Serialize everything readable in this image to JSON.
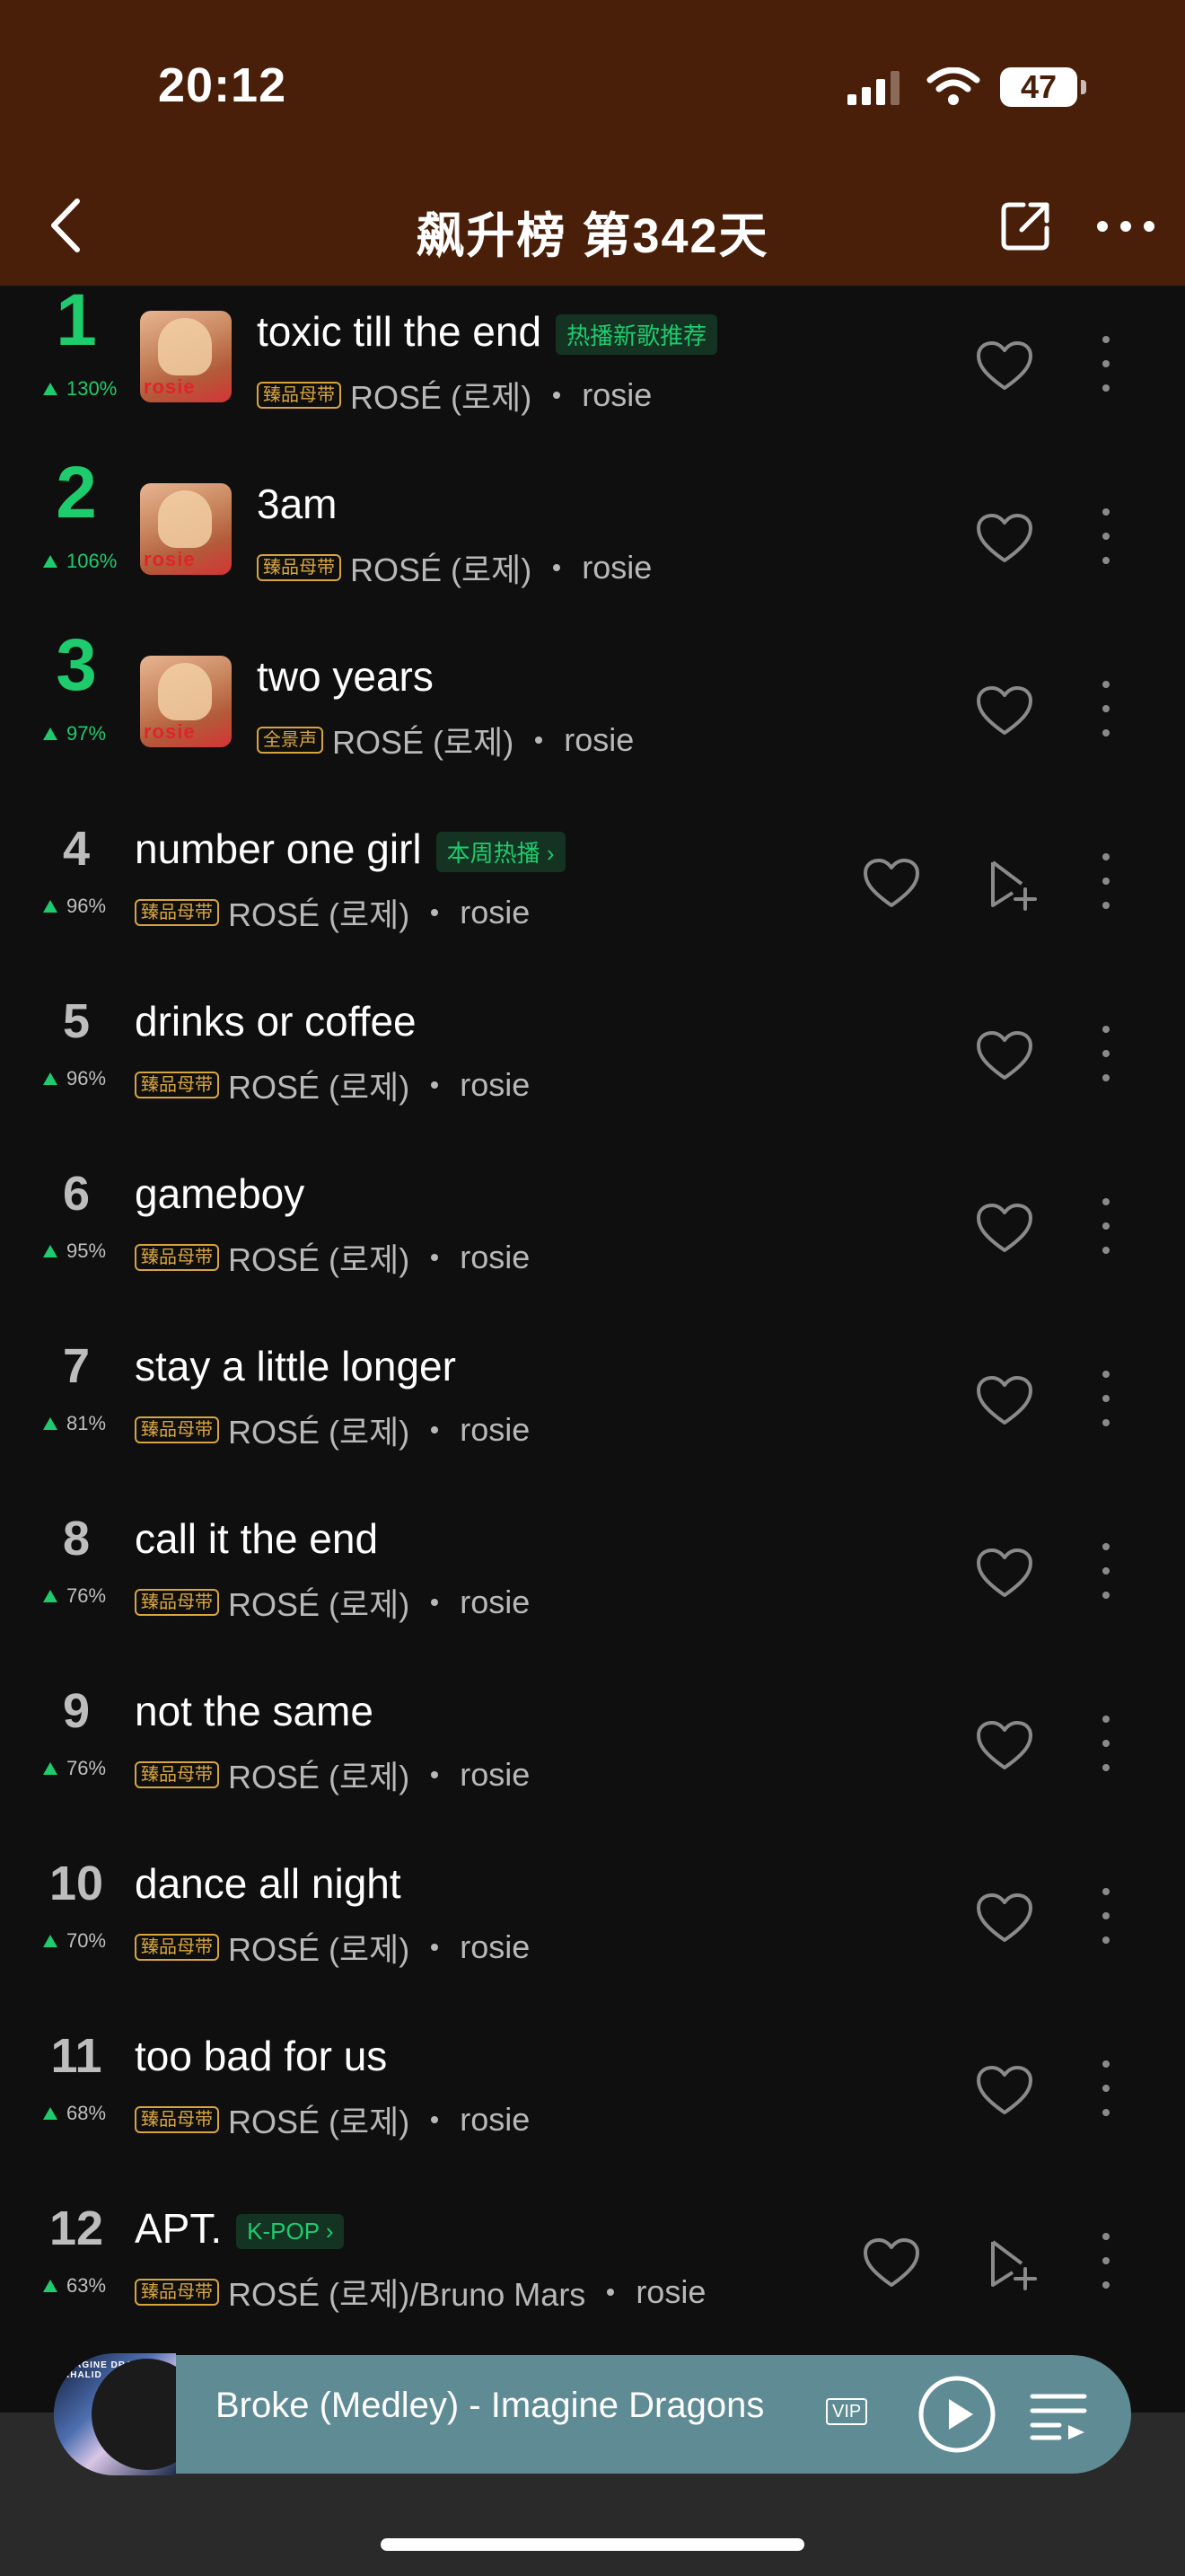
{
  "status_bar": {
    "time": "20:12",
    "battery": "47"
  },
  "header": {
    "title": "飙升榜 第342天"
  },
  "songs": [
    {
      "rank": "1",
      "trend": "130%",
      "title": "toxic till the end",
      "tag": "热播新歌推荐",
      "quality": "臻品母带",
      "artist": "ROSÉ (로제)",
      "album": "rosie",
      "cover_text": "rosie"
    },
    {
      "rank": "2",
      "trend": "106%",
      "title": "3am",
      "quality": "臻品母带",
      "artist": "ROSÉ (로제)",
      "album": "rosie",
      "cover_text": "rosie"
    },
    {
      "rank": "3",
      "trend": "97%",
      "title": "two years",
      "quality": "全景声",
      "artist": "ROSÉ (로제)",
      "album": "rosie",
      "cover_text": "rosie"
    },
    {
      "rank": "4",
      "trend": "96%",
      "title": "number one girl",
      "tag": "本周热播 ›",
      "quality": "臻品母带",
      "artist": "ROSÉ (로제)",
      "album": "rosie"
    },
    {
      "rank": "5",
      "trend": "96%",
      "title": "drinks or coffee",
      "quality": "臻品母带",
      "artist": "ROSÉ (로제)",
      "album": "rosie"
    },
    {
      "rank": "6",
      "trend": "95%",
      "title": "gameboy",
      "quality": "臻品母带",
      "artist": "ROSÉ (로제)",
      "album": "rosie"
    },
    {
      "rank": "7",
      "trend": "81%",
      "title": "stay a little longer",
      "quality": "臻品母带",
      "artist": "ROSÉ (로제)",
      "album": "rosie"
    },
    {
      "rank": "8",
      "trend": "76%",
      "title": "call it the end",
      "quality": "臻品母带",
      "artist": "ROSÉ (로제)",
      "album": "rosie"
    },
    {
      "rank": "9",
      "trend": "76%",
      "title": "not the same",
      "quality": "臻品母带",
      "artist": "ROSÉ (로제)",
      "album": "rosie"
    },
    {
      "rank": "10",
      "trend": "70%",
      "title": "dance all night",
      "quality": "臻品母带",
      "artist": "ROSÉ (로제)",
      "album": "rosie"
    },
    {
      "rank": "11",
      "trend": "68%",
      "title": "too bad for us",
      "quality": "臻品母带",
      "artist": "ROSÉ (로제)",
      "album": "rosie"
    },
    {
      "rank": "12",
      "trend": "63%",
      "title": "APT.",
      "tag": "K-POP ›",
      "quality": "臻品母带",
      "artist": "ROSÉ (로제)/Bruno Mars",
      "album": "rosie"
    }
  ],
  "player": {
    "title": "Broke (Medley) - Imagine Dragons",
    "vip": "VIP",
    "art_text": "IMAGINE DRAGONS • KHALID"
  }
}
